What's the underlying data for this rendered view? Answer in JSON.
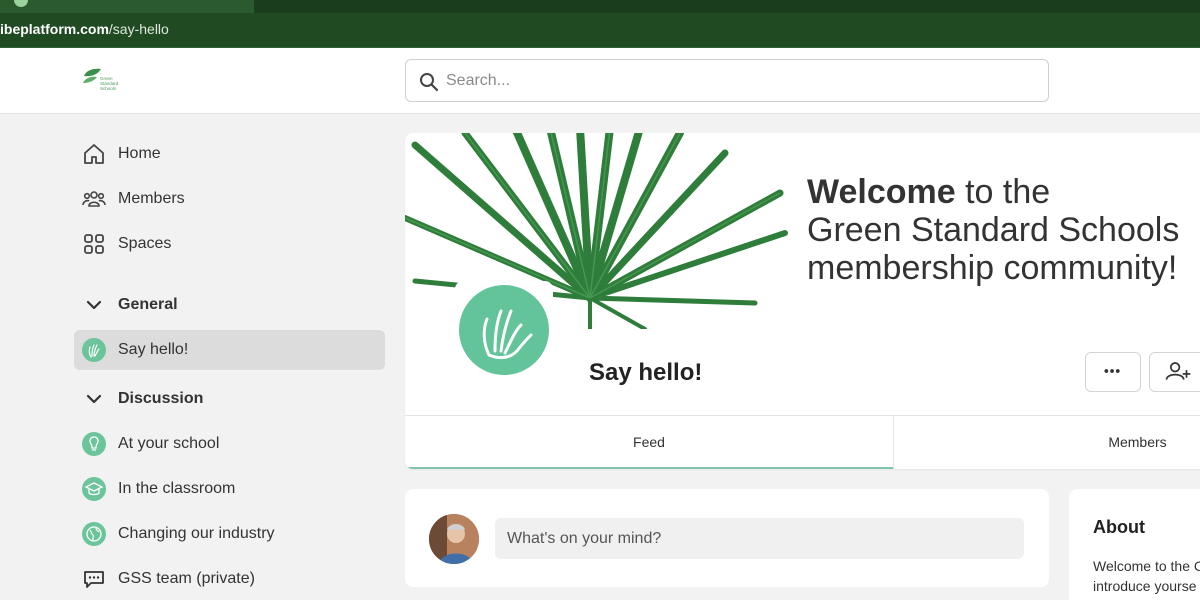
{
  "browser": {
    "url_host": "ibeplatform.com",
    "url_path": "/say-hello"
  },
  "header": {
    "logo_text": "Green\nStandard\nSchools",
    "search_placeholder": "Search..."
  },
  "sidebar": {
    "nav": [
      {
        "label": "Home",
        "icon": "home-icon"
      },
      {
        "label": "Members",
        "icon": "members-icon"
      },
      {
        "label": "Spaces",
        "icon": "spaces-icon"
      }
    ],
    "sections": [
      {
        "label": "General",
        "items": [
          {
            "label": "Say hello!",
            "active": true
          }
        ]
      },
      {
        "label": "Discussion",
        "items": [
          {
            "label": "At your school"
          },
          {
            "label": "In the classroom"
          },
          {
            "label": "Changing our industry"
          },
          {
            "label": "GSS team (private)"
          }
        ]
      }
    ]
  },
  "space": {
    "welcome_bold": "Welcome",
    "welcome_rest_line1": " to the",
    "welcome_line2": "Green Standard Schools",
    "welcome_line3": "membership community!",
    "title": "Say hello!",
    "more_label": "•••",
    "tabs": [
      {
        "label": "Feed"
      },
      {
        "label": "Members"
      }
    ]
  },
  "composer": {
    "placeholder": "What's on your mind?"
  },
  "about": {
    "title": "About",
    "line1": "Welcome to the C",
    "line2": "introduce yourse"
  },
  "colors": {
    "accent": "#63c49a",
    "chrome": "#1f4a22"
  }
}
